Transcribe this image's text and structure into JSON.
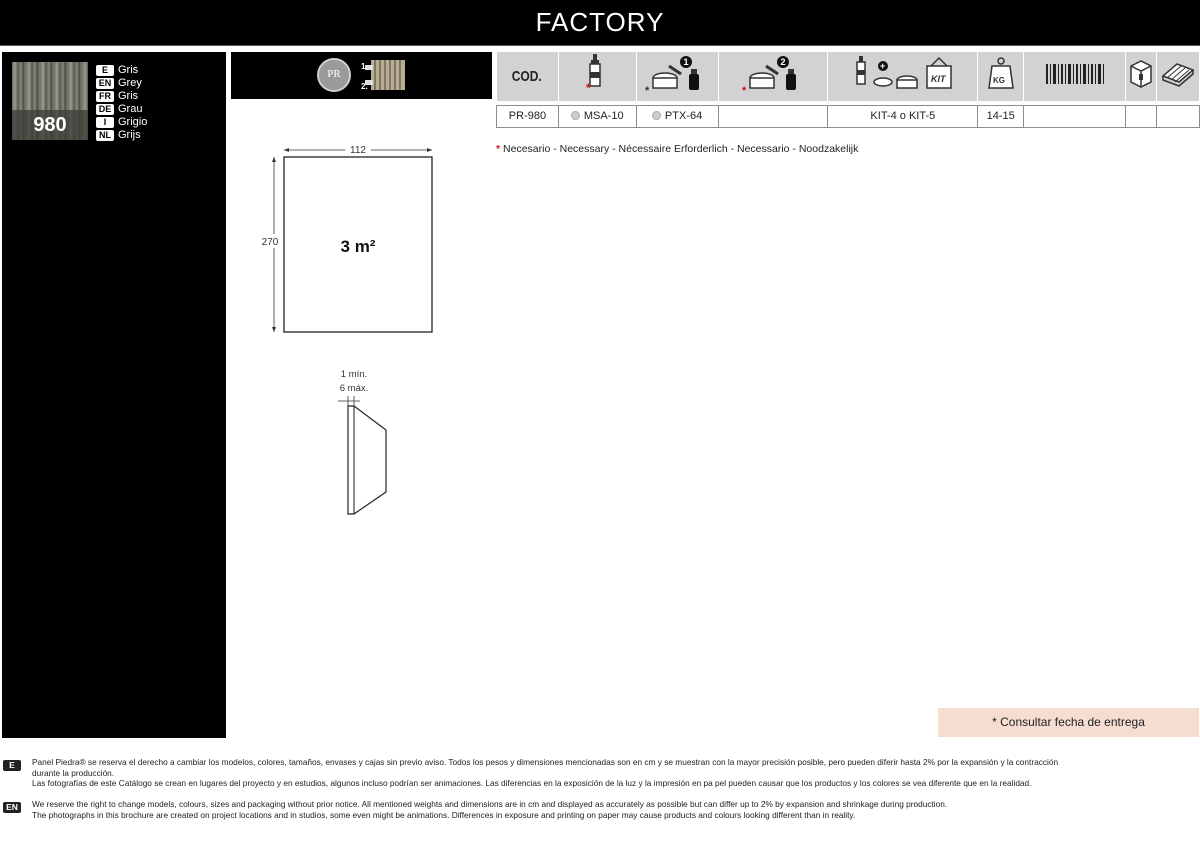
{
  "header": {
    "title": "FACTORY"
  },
  "product": {
    "code": "980",
    "colors": [
      {
        "lang": "E",
        "name": "Gris"
      },
      {
        "lang": "EN",
        "name": "Grey"
      },
      {
        "lang": "FR",
        "name": "Gris"
      },
      {
        "lang": "DE",
        "name": "Grau"
      },
      {
        "lang": "I",
        "name": "Grigio"
      },
      {
        "lang": "NL",
        "name": "Grijs"
      }
    ]
  },
  "install": {
    "badge": "PR",
    "step1": "1.",
    "step2": "2."
  },
  "table": {
    "cod_header": "COD.",
    "row": {
      "code": "PR-980",
      "adhesive": "MSA-10",
      "primer": "PTX-64",
      "kit": "KIT-4 o KIT-5",
      "weight": "14-15"
    }
  },
  "note": {
    "star": "*",
    "text": "Necesario - Necessary - Nécessaire  Erforderlich - Necessario - Noodzakelijk"
  },
  "dimensions": {
    "width": "112",
    "height": "270",
    "area": "3 m²",
    "thickness_min": "1 mín.",
    "thickness_max": "6 máx."
  },
  "delivery": "* Consultar fecha de entrega",
  "footer": {
    "es_tag": "E",
    "es_lines": [
      "Panel Piedra® se reserva el derecho a cambiar los modelos, colores, tamaños, envases y cajas sin previo aviso. Todos los pesos y dimensiones mencionadas son en cm y se muestran con la mayor precisión posible, pero pueden diferir hasta 2% por la expansión y la contracción",
      "durante la producción.",
      "Las fotografías de este Catálogo se crean en lugares del proyecto y en  estudios, algunos incluso podrían ser animaciones. Las diferencias en la exposición  de la luz y la impresión en pa                          pel pueden causar que los productos y los colores se vea diferente que en la realidad."
    ],
    "en_tag": "EN",
    "en_lines": [
      "We reserve the right to change models, colours, sizes and packaging without prior notice. All mentioned weights and dimensions are in cm and displayed as accurately as possible but can differ up to 2% by expansion and shrinkage during production.",
      "The photographs in this brochure are created on project locations and in studios, some even might be animations. Differences in exposure and printing on paper may cause products  and colours looking different than in reality."
    ]
  }
}
